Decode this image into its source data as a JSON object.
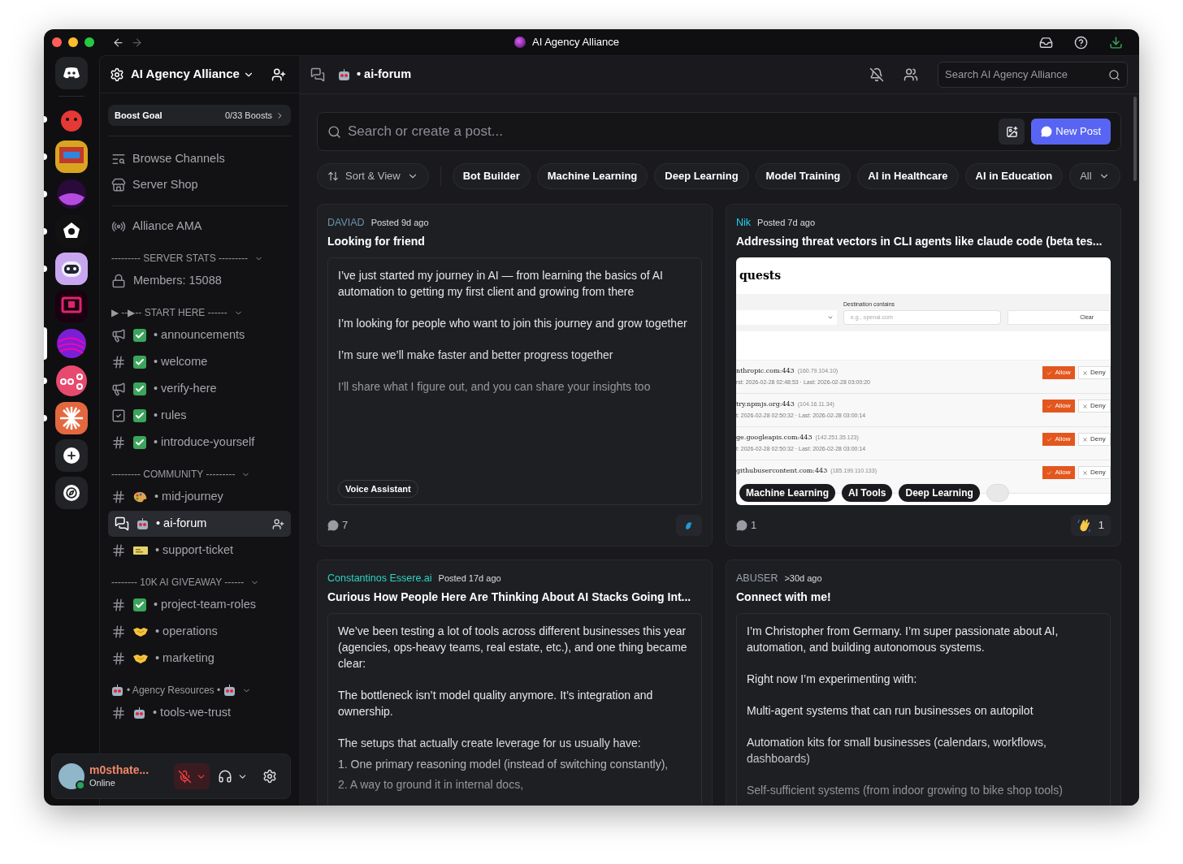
{
  "window": {
    "title": "AI Agency Alliance"
  },
  "servers": [
    {
      "kind": "blob",
      "unread": true,
      "selected": false
    },
    {
      "kind": "comic",
      "unread": true,
      "selected": false
    },
    {
      "kind": "orb",
      "unread": true,
      "selected": false
    },
    {
      "kind": "mark",
      "unread": true,
      "selected": false
    },
    {
      "kind": "robot",
      "unread": true,
      "selected": false
    },
    {
      "kind": "frame",
      "unread": false,
      "selected": false
    },
    {
      "kind": "swirl",
      "unread": false,
      "selected": true
    },
    {
      "kind": "nodes",
      "unread": true,
      "selected": false
    },
    {
      "kind": "burst",
      "unread": true,
      "selected": false
    }
  ],
  "sidebar": {
    "server_name": "AI Agency Alliance",
    "boost": {
      "label": "Boost Goal",
      "value": "0/33 Boosts"
    },
    "nav": [
      {
        "kind": "browse",
        "label": "Browse Channels"
      },
      {
        "kind": "shop",
        "label": "Server Shop"
      }
    ],
    "events": [
      {
        "kind": "stage",
        "label": "Alliance AMA"
      }
    ],
    "categories": [
      {
        "name": "--------- SERVER STATS ---------",
        "items": [
          {
            "kind": "lock",
            "label": "Members: 15088",
            "selected": false
          }
        ]
      },
      {
        "name": "▶ --▶-- START HERE ------",
        "items": [
          {
            "kind": "announce",
            "badge": {
              "kind": "check"
            },
            "label": "• announcements",
            "selected": false
          },
          {
            "kind": "text",
            "badge": {
              "kind": "check"
            },
            "label": "• welcome",
            "selected": false
          },
          {
            "kind": "announce",
            "badge": {
              "kind": "check"
            },
            "label": "• verify-here",
            "selected": false
          },
          {
            "kind": "rules",
            "badge": {
              "kind": "check"
            },
            "label": "• rules",
            "selected": false
          },
          {
            "kind": "text",
            "badge": {
              "kind": "check"
            },
            "label": "• introduce-yourself",
            "selected": false
          }
        ]
      },
      {
        "name": "--------- COMMUNITY ---------",
        "items": [
          {
            "kind": "text",
            "badge": {
              "kind": "palette"
            },
            "label": "• mid-journey",
            "selected": false
          },
          {
            "kind": "forum",
            "badge": {
              "kind": "robot"
            },
            "label": "• ai-forum",
            "selected": true
          },
          {
            "kind": "text",
            "badge": {
              "kind": "ticket"
            },
            "label": "• support-ticket",
            "selected": false
          }
        ]
      },
      {
        "name": "-------- 10K AI GIVEAWAY ------",
        "items": [
          {
            "kind": "text",
            "badge": {
              "kind": "check"
            },
            "label": "• project-team-roles",
            "selected": false
          },
          {
            "kind": "text",
            "badge": {
              "kind": "handshake"
            },
            "label": "• operations",
            "selected": false
          },
          {
            "kind": "text",
            "badge": {
              "kind": "handshake"
            },
            "label": "• marketing",
            "selected": false
          }
        ]
      },
      {
        "name": "• Agency Resources •",
        "badge": {
          "kind": "robot"
        },
        "items": [
          {
            "kind": "text",
            "badge": {
              "kind": "robot"
            },
            "label": "• tools-we-trust",
            "selected": false
          }
        ]
      }
    ]
  },
  "user": {
    "name": "m0sthate...",
    "status": "Online",
    "mic_muted": true
  },
  "header": {
    "channel": "• ai-forum",
    "badge": {
      "kind": "robot"
    },
    "search_placeholder": "Search AI Agency Alliance"
  },
  "forum": {
    "search_placeholder": "Search or create a post...",
    "new_post": "New Post",
    "sort": "Sort & View",
    "tags": [
      "Bot Builder",
      "Machine Learning",
      "Deep Learning",
      "Model Training",
      "AI in Healthcare",
      "AI in Education"
    ],
    "all": "All"
  },
  "posts": [
    {
      "author": "DAVIAD",
      "color": "#6b93ab",
      "posted": "Posted 9d ago",
      "title": "Looking for friend",
      "kind": "text",
      "paragraphs": [
        "I’ve just started my journey in AI — from learning the basics of AI automation to getting my first client and growing from there",
        "I’m looking for people who want to join this journey and grow together",
        "I’m sure we’ll make faster and better progress together",
        "I’ll share what I figure out, and you can share your insights too"
      ],
      "tags": [
        "Voice Assistant"
      ],
      "comments": "7",
      "reaction": {
        "kind": "bird"
      }
    },
    {
      "author": "Nik",
      "color": "#22d3ee",
      "posted": "Posted 7d ago",
      "title": "Addressing threat vectors in CLI agents like claude code (beta tes...",
      "kind": "image",
      "preview": {
        "heading": "quests",
        "filter_label": "Destination contains",
        "filter_placeholder": "e.g., openai.com",
        "clear": "Clear",
        "rows": [
          {
            "host": "nthropic.com:443",
            "ip": "(160.79.104.10)",
            "times": "rst: 2026-02-28 02:48:53 · Last: 2026-02-28 03:00:20",
            "allow": "Allow",
            "deny": "Deny"
          },
          {
            "host": "try.npmjs.org:443",
            "ip": "(104.16.11.34)",
            "times": "t: 2026-02-28 02:50:32 · Last: 2026-02-28 03:00:14",
            "allow": "Allow",
            "deny": "Deny"
          },
          {
            "host": "ge.googleapis.com:443",
            "ip": "(142.251.35.123)",
            "times": "t: 2026-02-28 02:50:32 · Last: 2026-02-28 03:00:14",
            "allow": "Allow",
            "deny": "Deny"
          },
          {
            "host": "githubusercontent.com:443",
            "ip": "(185.199.110.133)",
            "allow": "Allow",
            "deny": "Deny"
          }
        ]
      },
      "tags": [
        "Machine Learning",
        "AI Tools",
        "Deep Learning"
      ],
      "comments": "1",
      "reaction": {
        "kind": "wave",
        "count": "1"
      }
    },
    {
      "author": "Constantinos Essere.ai",
      "color": "#2dd4bf",
      "posted": "Posted 17d ago",
      "title": "Curious How People Here Are Thinking About AI Stacks Going Int...",
      "kind": "text",
      "paragraphs": [
        "We’ve been testing a lot of tools across different businesses this year (agencies, ops-heavy teams, real estate, etc.), and one thing became clear:",
        "The bottleneck isn’t model quality anymore. It’s integration and ownership.",
        "The setups that actually create leverage for us usually have:"
      ],
      "list": [
        "1. One primary reasoning model (instead of switching constantly),",
        "2. A way to ground it in internal docs,"
      ]
    },
    {
      "author": "ABUSER",
      "color": "#9ca3af",
      "posted": ">30d ago",
      "title": "Connect with me!",
      "kind": "text",
      "paragraphs": [
        "I’m Christopher from Germany. I’m super passionate about AI, automation, and building autonomous systems.",
        "Right now I’m experimenting with:",
        "Multi-agent systems that can run businesses on autopilot",
        "Automation kits for small businesses (calendars, workflows, dashboards)",
        "Self-sufficient systems (from indoor growing to bike shop tools)"
      ]
    }
  ]
}
